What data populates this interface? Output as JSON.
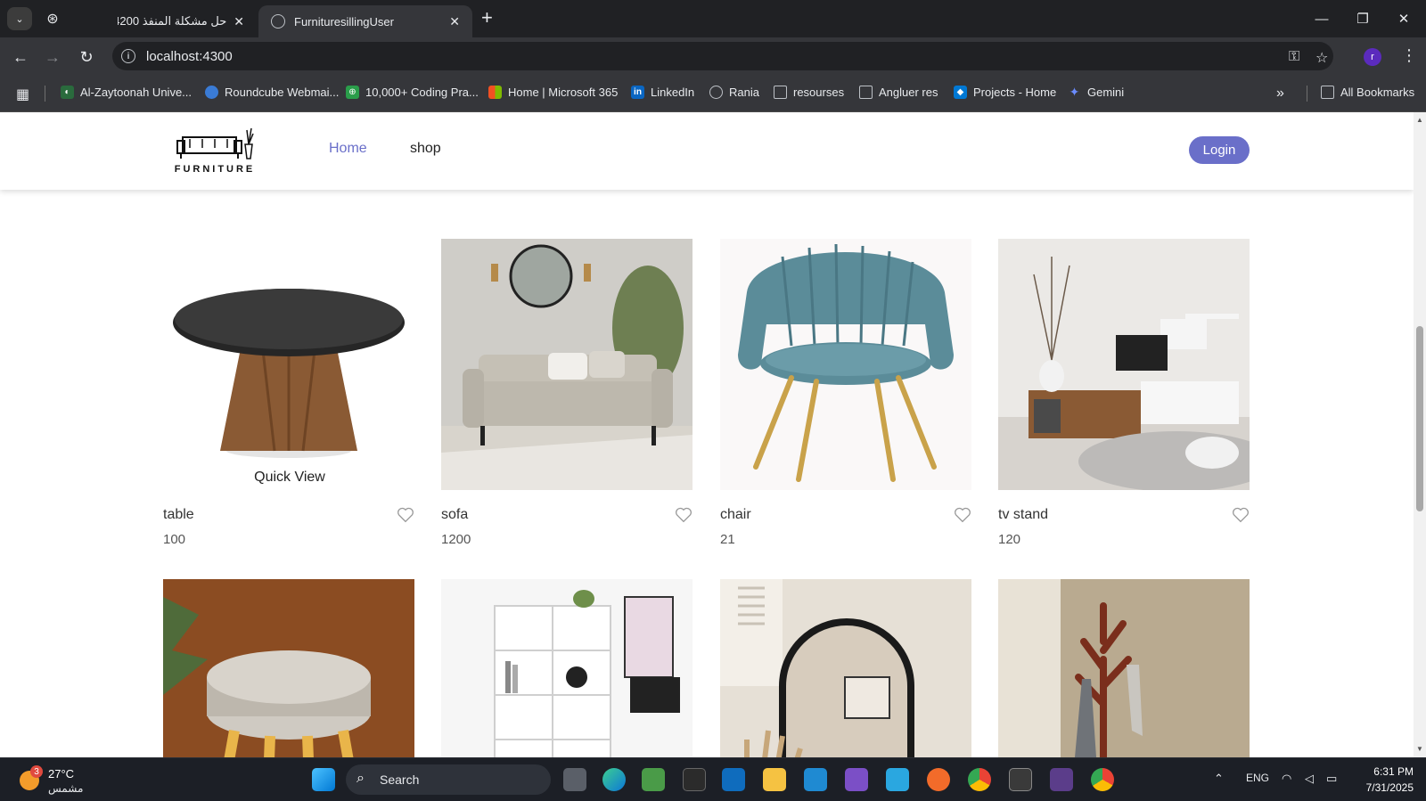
{
  "browser": {
    "tabs": [
      {
        "title": "حل مشكلة المنفذ 4200",
        "active": false
      },
      {
        "title": "FurnituresillingUser",
        "active": true
      }
    ],
    "new_tab": "+",
    "url": "localhost:4300",
    "profile_initial": "r",
    "bookmarks": [
      {
        "label": "Al-Zaytoonah Unive...",
        "icon": "zaytoonah-icon"
      },
      {
        "label": "Roundcube Webmai...",
        "icon": "roundcube-icon"
      },
      {
        "label": "10,000+ Coding Pra...",
        "icon": "coding-icon"
      },
      {
        "label": "Home | Microsoft 365",
        "icon": "microsoft-icon"
      },
      {
        "label": "LinkedIn",
        "icon": "linkedin-icon"
      },
      {
        "label": "Rania",
        "icon": "globe-icon"
      },
      {
        "label": "resourses",
        "icon": "folder-icon"
      },
      {
        "label": "Angluer res",
        "icon": "folder-icon"
      },
      {
        "label": "Projects - Home",
        "icon": "projects-icon"
      },
      {
        "label": "Gemini",
        "icon": "gemini-icon"
      }
    ],
    "all_bookmarks": "All Bookmarks"
  },
  "site": {
    "logo_text": "FURNITURE",
    "nav": {
      "home": "Home",
      "shop": "shop"
    },
    "login": "Login",
    "accent_color": "#6a6fc9",
    "quick_view": "Quick View",
    "products": [
      {
        "name": "table",
        "price": "100"
      },
      {
        "name": "sofa",
        "price": "1200"
      },
      {
        "name": "chair",
        "price": "21"
      },
      {
        "name": "tv stand",
        "price": "120"
      },
      {
        "name": "",
        "price": ""
      },
      {
        "name": "",
        "price": ""
      },
      {
        "name": "",
        "price": ""
      },
      {
        "name": "",
        "price": ""
      }
    ]
  },
  "taskbar": {
    "weather_temp": "27°C",
    "weather_condition": "مشمس",
    "weather_badge": "3",
    "search_label": "Search",
    "language": "ENG",
    "time": "6:31 PM",
    "date": "7/31/2025"
  }
}
